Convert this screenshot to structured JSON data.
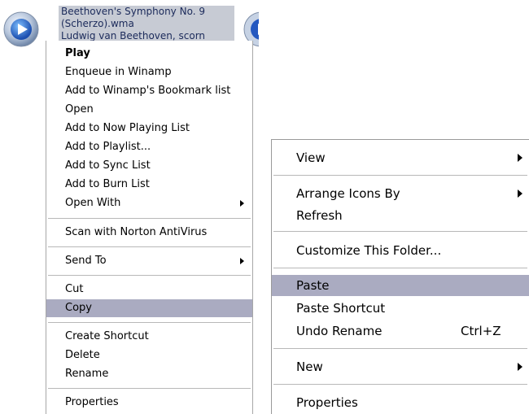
{
  "file": {
    "name_line1": "Beethoven's Symphony No. 9",
    "name_line2": "(Scherzo).wma",
    "name_line3": "Ludwig van Beethoven, scorn",
    "icon": "windows-media-audio-icon"
  },
  "file_menu": {
    "items": [
      {
        "label": "Play"
      },
      {
        "label": "Enqueue in Winamp"
      },
      {
        "label": "Add to Winamp's Bookmark list"
      },
      {
        "label": "Open"
      },
      {
        "label": "Add to Now Playing List"
      },
      {
        "label": "Add to Playlist..."
      },
      {
        "label": "Add to Sync List"
      },
      {
        "label": "Add to Burn List"
      },
      {
        "label": "Open With"
      },
      {
        "label": "Scan with Norton AntiVirus"
      },
      {
        "label": "Send To"
      },
      {
        "label": "Cut"
      },
      {
        "label": "Copy"
      },
      {
        "label": "Create Shortcut"
      },
      {
        "label": "Delete"
      },
      {
        "label": "Rename"
      },
      {
        "label": "Properties"
      }
    ]
  },
  "folder_menu": {
    "items": [
      {
        "label": "View"
      },
      {
        "label": "Arrange Icons By"
      },
      {
        "label": "Refresh"
      },
      {
        "label": "Customize This Folder..."
      },
      {
        "label": "Paste"
      },
      {
        "label": "Paste Shortcut"
      },
      {
        "label": "Undo Rename",
        "shortcut": "Ctrl+Z"
      },
      {
        "label": "New"
      },
      {
        "label": "Properties"
      }
    ]
  },
  "colors": {
    "highlight": "#aaabc1",
    "selection_label": "#c7cbd4"
  }
}
